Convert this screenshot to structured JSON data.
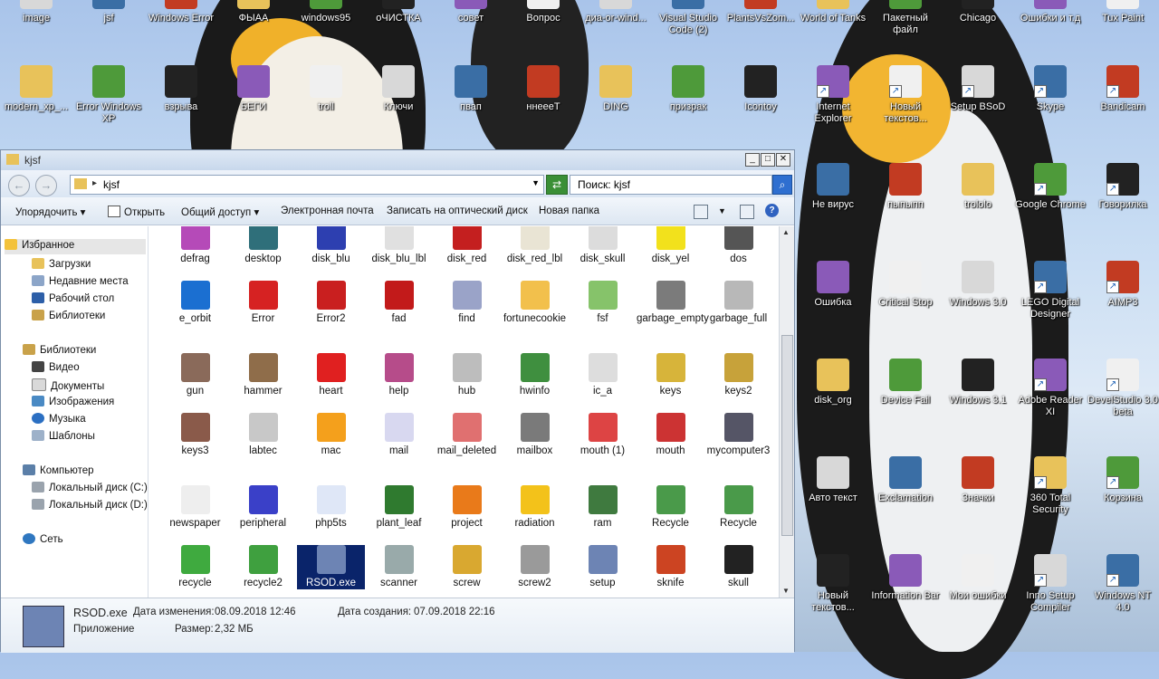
{
  "desktop": {
    "row1": [
      "image",
      "jsf",
      "Windows Error",
      "ФЫАА",
      "windows95",
      "оЧИСТКА",
      "совет",
      "Вопрос",
      "диа-or-wind...",
      "Visual Studio Code (2)",
      "PlantsVsZom...",
      "World of Tanks",
      "Пакетный файл",
      "Chicago",
      "Ошибки и т.д",
      "Tux Paint"
    ],
    "row2": [
      "modern_xp_...",
      "Error Windows XP",
      "взрыва",
      "БЕГИ",
      "troll",
      "Ключи",
      "пвап",
      "ннеееТ",
      "DING",
      "призрак",
      "Icontoy",
      "Internet Explorer",
      "Новый текстов...",
      "Setup BSoD",
      "Skype",
      "Bandicam"
    ],
    "right": [
      [
        "Не вирус",
        "пыпыпп",
        "trololo",
        "Google Chrome",
        "Говорилка"
      ],
      [
        "Ошибка",
        "Critical Stop",
        "Windows 3.0",
        "LEGO Digital Designer",
        "AIMP3"
      ],
      [
        "disk_org",
        "Device Fail",
        "Windows 3.1",
        "Adobe Reader XI",
        "DevelStudio 3.0 beta"
      ],
      [
        "Авто текст",
        "Exclamation",
        "Значки",
        "360 Total Security",
        "Корзина"
      ],
      [
        "Новый текстов...",
        "Information Bar",
        "Мои ошибки",
        "Inno Setup Compiler",
        "Windows NT 4.0"
      ]
    ]
  },
  "window": {
    "title": "kjsf",
    "path": "kjsf",
    "search_placeholder": "Поиск: kjsf",
    "toolbar": {
      "organize": "Упорядочить",
      "open": "Открыть",
      "share": "Общий доступ",
      "email": "Электронная почта",
      "burn": "Записать на оптический диск",
      "new_folder": "Новая папка"
    },
    "nav": {
      "favorites": "Избранное",
      "downloads": "Загрузки",
      "recent": "Недавние места",
      "desktop": "Рабочий стол",
      "libraries_fav": "Библиотеки",
      "libraries": "Библиотеки",
      "video": "Видео",
      "documents": "Документы",
      "images": "Изображения",
      "music": "Музыка",
      "templates": "Шаблоны",
      "computer": "Компьютер",
      "disk_c": "Локальный диск (C:)",
      "disk_d": "Локальный диск (D:)",
      "network": "Сеть"
    },
    "files": [
      [
        "defrag",
        "desktop",
        "disk_blu",
        "disk_blu_lbl",
        "disk_red",
        "disk_red_lbl",
        "disk_skull",
        "disk_yel",
        "dos"
      ],
      [
        "e_orbit",
        "Error",
        "Error2",
        "fad",
        "find",
        "fortunecookie",
        "fsf",
        "garbage_empty",
        "garbage_full"
      ],
      [
        "gun",
        "hammer",
        "heart",
        "help",
        "hub",
        "hwinfo",
        "ic_a",
        "keys",
        "keys2"
      ],
      [
        "keys3",
        "labtec",
        "mac",
        "mail",
        "mail_deleted",
        "mailbox",
        "mouth (1)",
        "mouth",
        "mycomputer3"
      ],
      [
        "newspaper",
        "peripheral",
        "php5ts",
        "plant_leaf",
        "project",
        "radiation",
        "ram",
        "Recycle",
        "Recycle"
      ],
      [
        "recycle",
        "recycle2",
        "RSOD.exe",
        "scanner",
        "screw",
        "screw2",
        "setup",
        "sknife",
        "skull"
      ]
    ],
    "details": {
      "name": "RSOD.exe",
      "type": "Приложение",
      "modified_label": "Дата изменения:",
      "modified": "08.09.2018 12:46",
      "created_label": "Дата создания:",
      "created": "07.09.2018 22:16",
      "size_label": "Размер:",
      "size": "2,32 МБ"
    }
  }
}
